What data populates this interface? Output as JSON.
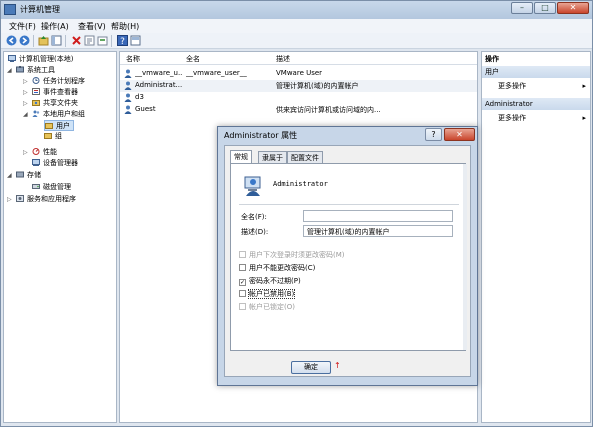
{
  "window": {
    "title": "计算机管理",
    "min_label": "–",
    "max_label": "□",
    "close_label": "✕"
  },
  "menu": [
    "文件(F)",
    "操作(A)",
    "查看(V)",
    "帮助(H)"
  ],
  "toolbar": [
    "back-icon",
    "forward-icon",
    "up-icon",
    "show-hide-icon",
    "delete-icon",
    "properties-icon",
    "export-icon",
    "help-icon",
    "view-icon"
  ],
  "tree": [
    {
      "label": "计算机管理(本地)",
      "level": 0,
      "expander": "",
      "icon": "computer-icon"
    },
    {
      "label": "系统工具",
      "level": 1,
      "expander": "◢",
      "icon": "tools-icon"
    },
    {
      "label": "任务计划程序",
      "level": 2,
      "expander": "▷",
      "icon": "clock-icon"
    },
    {
      "label": "事件查看器",
      "level": 2,
      "expander": "▷",
      "icon": "event-icon"
    },
    {
      "label": "共享文件夹",
      "level": 2,
      "expander": "▷",
      "icon": "share-icon"
    },
    {
      "label": "本地用户和组",
      "level": 2,
      "expander": "◢",
      "icon": "users-icon"
    },
    {
      "label": "用户",
      "level": 3,
      "expander": "",
      "icon": "folder-icon",
      "selected": true
    },
    {
      "label": "组",
      "level": 3,
      "expander": "",
      "icon": "folder-icon"
    },
    {
      "label": "性能",
      "level": 2,
      "expander": "▷",
      "icon": "perf-icon"
    },
    {
      "label": "设备管理器",
      "level": 2,
      "expander": "",
      "icon": "device-icon"
    },
    {
      "label": "存储",
      "level": 1,
      "expander": "◢",
      "icon": "storage-icon"
    },
    {
      "label": "磁盘管理",
      "level": 2,
      "expander": "",
      "icon": "disk-icon"
    },
    {
      "label": "服务和应用程序",
      "level": 1,
      "expander": "▷",
      "icon": "services-icon"
    }
  ],
  "list": {
    "headers": [
      "名称",
      "全名",
      "描述"
    ],
    "rows": [
      {
        "name": "__vmware_u...",
        "fullname": "__vmware_user__",
        "desc": "VMware User"
      },
      {
        "name": "Administrat...",
        "fullname": "",
        "desc": "管理计算机(域)的内置帐户",
        "highlight": true
      },
      {
        "name": "d3",
        "fullname": "",
        "desc": ""
      },
      {
        "name": "Guest",
        "fullname": "",
        "desc": "供来宾访问计算机或访问域的内..."
      }
    ]
  },
  "actions": {
    "title": "操作",
    "groups": [
      {
        "header": "用户",
        "item": "更多操作",
        "arrow": "▸"
      },
      {
        "header": "Administrator",
        "item": "更多操作",
        "arrow": "▸"
      }
    ]
  },
  "dialog": {
    "title": "Administrator 属性",
    "help_label": "?",
    "close_label": "✕",
    "tabs": [
      "常规",
      "隶属于",
      "配置文件"
    ],
    "username": "Administrator",
    "fullname_label": "全名(F):",
    "fullname_value": "",
    "desc_label": "描述(D):",
    "desc_value": "管理计算机(域)的内置帐户",
    "checkboxes": [
      {
        "label": "用户下次登录时须更改密码(M)",
        "checked": false,
        "disabled": true
      },
      {
        "label": "用户不能更改密码(C)",
        "checked": false,
        "disabled": false
      },
      {
        "label": "密码永不过期(P)",
        "checked": true,
        "disabled": false
      },
      {
        "label": "帐户已禁用(B)",
        "checked": false,
        "disabled": false,
        "focus": true
      },
      {
        "label": "帐户已锁定(O)",
        "checked": false,
        "disabled": true
      }
    ],
    "ok_label": "确定",
    "red_mark": "↑"
  }
}
